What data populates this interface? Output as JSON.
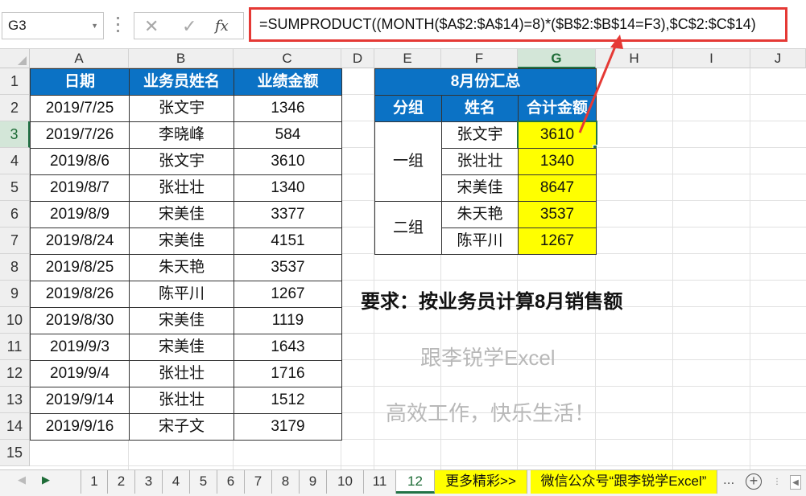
{
  "formula_bar": {
    "name_box": "G3",
    "cancel_icon": "✕",
    "enter_icon": "✓",
    "fx_label": "fx",
    "formula": "=SUMPRODUCT((MONTH($A$2:$A$14)=8)*($B$2:$B$14=F3),$C$2:$C$14)"
  },
  "columns": [
    "A",
    "B",
    "C",
    "D",
    "E",
    "F",
    "G",
    "H",
    "I",
    "J"
  ],
  "rows": [
    "1",
    "2",
    "3",
    "4",
    "5",
    "6",
    "7",
    "8",
    "9",
    "10",
    "11",
    "12",
    "13",
    "14",
    "15"
  ],
  "data_table": {
    "headers": [
      "日期",
      "业务员姓名",
      "业绩金额"
    ],
    "rows": [
      [
        "2019/7/25",
        "张文宇",
        "1346"
      ],
      [
        "2019/7/26",
        "李晓峰",
        "584"
      ],
      [
        "2019/8/6",
        "张文宇",
        "3610"
      ],
      [
        "2019/8/7",
        "张壮壮",
        "1340"
      ],
      [
        "2019/8/9",
        "宋美佳",
        "3377"
      ],
      [
        "2019/8/24",
        "宋美佳",
        "4151"
      ],
      [
        "2019/8/25",
        "朱天艳",
        "3537"
      ],
      [
        "2019/8/26",
        "陈平川",
        "1267"
      ],
      [
        "2019/8/30",
        "宋美佳",
        "1119"
      ],
      [
        "2019/9/3",
        "宋美佳",
        "1643"
      ],
      [
        "2019/9/4",
        "张壮壮",
        "1716"
      ],
      [
        "2019/9/14",
        "张壮壮",
        "1512"
      ],
      [
        "2019/9/16",
        "宋子文",
        "3179"
      ]
    ]
  },
  "summary": {
    "title": "8月份汇总",
    "headers": [
      "分组",
      "姓名",
      "合计金额"
    ],
    "groups": [
      {
        "name": "一组",
        "rows": [
          [
            "张文宇",
            "3610"
          ],
          [
            "张壮壮",
            "1340"
          ],
          [
            "宋美佳",
            "8647"
          ]
        ]
      },
      {
        "name": "二组",
        "rows": [
          [
            "朱天艳",
            "3537"
          ],
          [
            "陈平川",
            "1267"
          ]
        ]
      }
    ]
  },
  "requirement": "要求：按业务员计算8月销售额",
  "watermark_line1": "跟李锐学Excel",
  "watermark_line2": "高效工作，快乐生活！",
  "accent_color": "#e53935",
  "header_fill": "#0b72c5",
  "highlight_fill": "#ffff00",
  "sheet_tabs": {
    "tabs": [
      "1",
      "2",
      "3",
      "4",
      "5",
      "6",
      "7",
      "8",
      "9",
      "10",
      "11",
      "12"
    ],
    "active": "12",
    "extra1": "更多精彩>>",
    "extra2": "微信公众号“跟李锐学Excel”",
    "more": "...",
    "add_icon": "+"
  }
}
